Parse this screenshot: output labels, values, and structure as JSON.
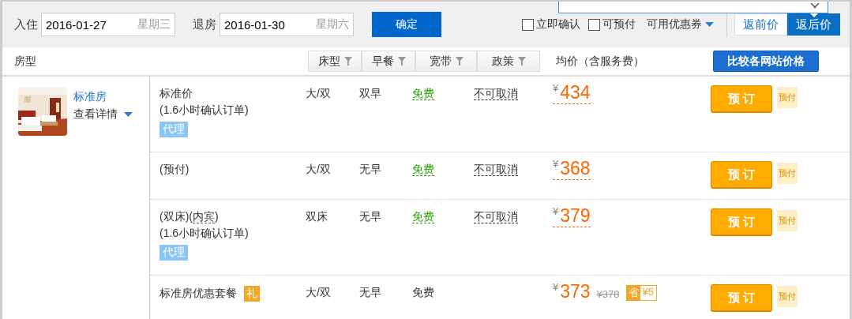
{
  "search_bar": {
    "checkin": {
      "label": "入住",
      "date": "2016-01-27",
      "weekday": "星期三"
    },
    "checkout": {
      "label": "退房",
      "date": "2016-01-30",
      "weekday": "星期六"
    },
    "confirm_button": "确定",
    "checkboxes": [
      {
        "label": "立即确认",
        "checked": false
      },
      {
        "label": "可预付",
        "checked": false
      }
    ],
    "coupon_dropdown": "可用优惠券",
    "price_toggle": [
      {
        "label": "返前价",
        "selected": false
      },
      {
        "label": "返后价",
        "selected": true
      }
    ]
  },
  "header": {
    "room_type": "房型",
    "filters": [
      "床型",
      "早餐",
      "宽带",
      "政策"
    ],
    "avg_price": "均价（含服务费）",
    "compare_button": "比较各网站价格"
  },
  "room": {
    "name": "标准房",
    "details_link": "查看详情",
    "rates": [
      {
        "name_parts": [
          {
            "text": "标准价",
            "kind": "text"
          }
        ],
        "note": "(1.6小时确认订单)",
        "tag": "代理",
        "bed": "大/双",
        "breakfast": "双早",
        "broadband": "免费",
        "broadband_highlighted": true,
        "policy": "不可取消",
        "currency": "¥",
        "price": "434",
        "price_underlined": true,
        "book_button": "预 订",
        "pay_tag": "预付"
      },
      {
        "name_parts": [
          {
            "text": "(预付)",
            "kind": "text"
          }
        ],
        "bed": "大/双",
        "breakfast": "无早",
        "broadband": "免费",
        "broadband_highlighted": true,
        "policy": "不可取消",
        "currency": "¥",
        "price": "368",
        "price_underlined": true,
        "book_button": "预 订",
        "pay_tag": "预付"
      },
      {
        "name_parts": [
          {
            "text": "(双床)(",
            "kind": "text"
          },
          {
            "text": "内宾",
            "kind": "term"
          },
          {
            "text": ")",
            "kind": "text"
          }
        ],
        "note": "(1.6小时确认订单)",
        "tag": "代理",
        "bed": "双床",
        "breakfast": "无早",
        "broadband": "免费",
        "broadband_highlighted": true,
        "policy": "不可取消",
        "currency": "¥",
        "price": "379",
        "price_underlined": true,
        "book_button": "预 订",
        "pay_tag": "预付"
      },
      {
        "name_parts": [
          {
            "text": "标准房优惠套餐",
            "kind": "text"
          }
        ],
        "gift": "礼",
        "bed": "大/双",
        "breakfast": "无早",
        "broadband": "免费",
        "broadband_highlighted": false,
        "currency": "¥",
        "price": "373",
        "price_underlined": false,
        "original_price": "¥378",
        "saving_label": "省",
        "saving": "¥5",
        "book_button": "预 订",
        "pay_tag": "预付"
      }
    ]
  }
}
